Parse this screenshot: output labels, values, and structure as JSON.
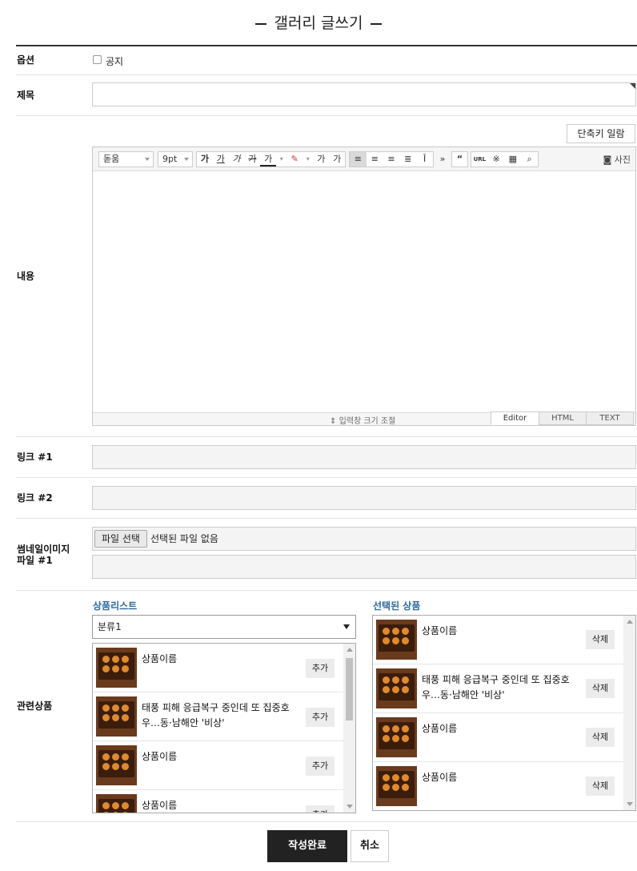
{
  "page": {
    "title": "갤러리 글쓰기"
  },
  "form": {
    "option": {
      "label": "옵션",
      "checkbox_label": "공지",
      "checked": false
    },
    "subject": {
      "label": "제목",
      "value": ""
    },
    "content": {
      "label": "내용",
      "shortcut_button": "단축키 일람",
      "font_family": "돋움",
      "font_size": "9pt",
      "photo_button": "사진",
      "resize_label": "입력창 크기 조절",
      "tabs": [
        "Editor",
        "HTML",
        "TEXT"
      ],
      "active_tab": "Editor",
      "toolbar": {
        "style_buttons": [
          "가",
          "가",
          "가",
          "가",
          "가"
        ],
        "sub_buttons": [
          "가",
          "가"
        ],
        "url_button": "URL",
        "more_icon": "»",
        "quote_icon": "“"
      }
    },
    "link1": {
      "label": "링크 #1",
      "value": ""
    },
    "link2": {
      "label": "링크 #2",
      "value": ""
    },
    "thumbnail": {
      "label_line1": "썸네일이미지",
      "label_line2": "파일 #1",
      "file_button": "파일 선택",
      "file_status": "선택된 파일 없음"
    },
    "related": {
      "label": "관련상품",
      "list_heading": "상품리스트",
      "selected_heading": "선택된 상품",
      "category_select": "분류1",
      "product_list": [
        {
          "name": "상품이름",
          "action": "추가"
        },
        {
          "name": "태풍 피해 응급복구 중인데 또 집중호우…동·남해안 '비상'",
          "action": "추가"
        },
        {
          "name": "상품이름",
          "action": "추가"
        },
        {
          "name": "상품이름",
          "action": "추가"
        }
      ],
      "selected_list": [
        {
          "name": "상품이름",
          "action": "삭제"
        },
        {
          "name": "태풍 피해 응급복구 중인데 또 집중호우…동·남해안 '비상'",
          "action": "삭제"
        },
        {
          "name": "상품이름",
          "action": "삭제"
        },
        {
          "name": "상품이름",
          "action": "삭제"
        }
      ]
    }
  },
  "buttons": {
    "submit": "작성완료",
    "cancel": "취소"
  }
}
